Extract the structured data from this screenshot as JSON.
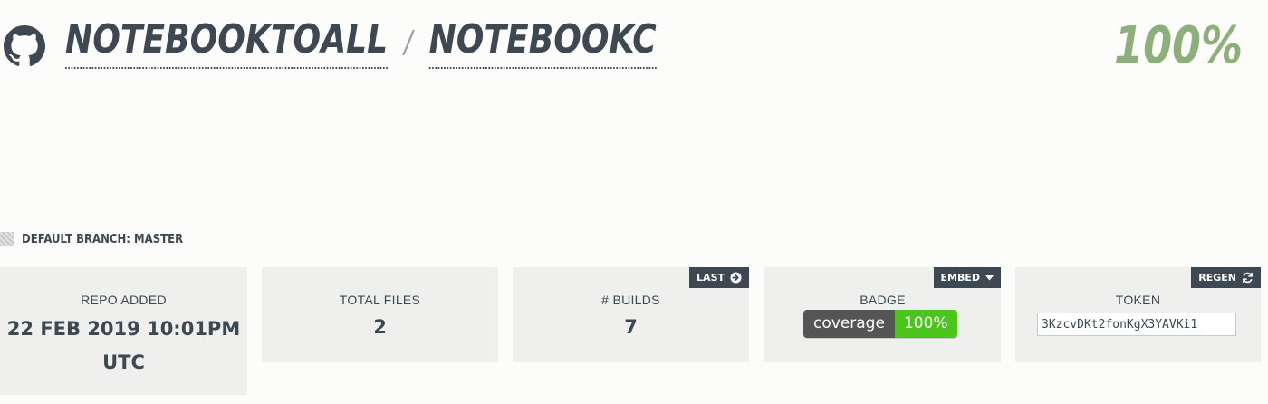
{
  "header": {
    "owner": "NOTEBOOKTOALL",
    "separator": "/",
    "repo": "NOTEBOOKC",
    "coverage": "100%",
    "coverage_color": "#8db07a"
  },
  "branch": {
    "label": "DEFAULT BRANCH: MASTER"
  },
  "cards": {
    "repo_added": {
      "label": "REPO ADDED",
      "date": "22 FEB 2019 10:01PM",
      "tz": "UTC"
    },
    "total_files": {
      "label": "TOTAL FILES",
      "value": "2"
    },
    "builds": {
      "label": "# BUILDS",
      "value": "7",
      "button": "LAST",
      "button_icon": "arrow-right-circle-icon"
    },
    "badge": {
      "label": "BADGE",
      "left": "coverage",
      "right": "100%",
      "right_color": "#4bc51d",
      "button": "EMBED",
      "button_icon": "caret-down-icon"
    },
    "token": {
      "label": "TOKEN",
      "value": "3KzcvDKt2fonKgX3YAVKi1",
      "button": "REGEN",
      "button_icon": "refresh-icon"
    }
  },
  "colors": {
    "dark": "#3d4852",
    "card_bg": "#eff0ee",
    "page_bg": "#fcfcfa"
  }
}
